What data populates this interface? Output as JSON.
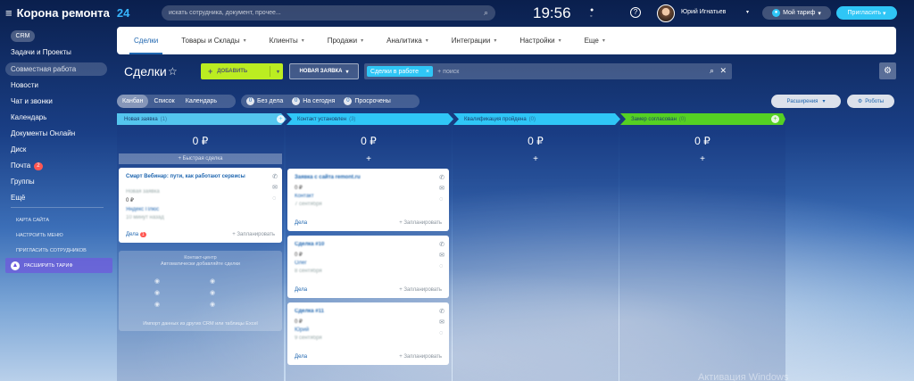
{
  "app": {
    "name": "Корона ремонта",
    "accent": "24",
    "accent_color": "#37b5ff"
  },
  "topbar": {
    "search_placeholder": "искать сотрудника, документ, прочее...",
    "time": "19:56",
    "user_name": "Юрий Игнатьев",
    "tariff_label": "Мой тариф",
    "invite_label": "Пригласить"
  },
  "sidebar": {
    "crm_label": "CRM",
    "items": [
      "Задачи и Проекты",
      "Совместная работа",
      "Новости",
      "Чат и звонки",
      "Календарь",
      "Документы Онлайн",
      "Диск",
      "Почта",
      "Группы",
      "Ещё"
    ],
    "mail_count": "2",
    "small_links": [
      "Карта сайта",
      "Настроить меню",
      "Пригласить сотрудников"
    ],
    "expand_label": "Расширить тариф"
  },
  "mainnav": {
    "items": [
      "Сделки",
      "Товары и Склады",
      "Клиенты",
      "Продажи",
      "Аналитика",
      "Интеграции",
      "Настройки",
      "Еще"
    ]
  },
  "toolbar": {
    "title": "Сделки",
    "add_label": "ДОБАВИТЬ",
    "new_request_label": "НОВАЯ ЗАЯВКА",
    "filter_chip": "Сделки в работе",
    "filter_placeholder": "+ поиск"
  },
  "views": {
    "tabs": [
      "Канбан",
      "Список",
      "Календарь"
    ],
    "counters": [
      {
        "count": "0",
        "label": "Без дела"
      },
      {
        "count": "0",
        "label": "На сегодня"
      },
      {
        "count": "0",
        "label": "Просрочены"
      }
    ],
    "extensions_label": "Расширения",
    "robots_label": "Роботы"
  },
  "columns": [
    {
      "title": "Новая заявка",
      "count": "(1)",
      "color": "#54c5ee",
      "sum": "0 ₽"
    },
    {
      "title": "Контакт установлен",
      "count": "(3)",
      "color": "#2fc6f6",
      "sum": "0 ₽"
    },
    {
      "title": "Квалификация пройдена",
      "count": "(0)",
      "color": "#2fc6f6",
      "sum": "0 ₽"
    },
    {
      "title": "Замер согласован",
      "count": "(0)",
      "color": "#55d123",
      "sum": "0 ₽"
    }
  ],
  "quick_deal_label": "+ Быстрая сделка",
  "cards": {
    "first": {
      "title": "Смарт Вебинар: пути, как работают сервисы",
      "subtitle": "Новая заявка",
      "amount": "0 ₽",
      "company": "Яндекс Плюс",
      "time": "10 минут назад",
      "foot_left": "Дела",
      "foot_badge": "1",
      "foot_right": "+ Запланировать"
    },
    "second": [
      {
        "title": "Заявка с сайта remont.ru",
        "amount": "0 ₽",
        "contact": "Контакт",
        "date": "7 сентября",
        "foot_left": "Дела",
        "foot_right": "+ Запланировать"
      },
      {
        "title": "Сделка #10",
        "amount": "0 ₽",
        "contact": "Олег",
        "date": "8 сентября",
        "foot_left": "Дела",
        "foot_right": "+ Запланировать"
      },
      {
        "title": "Сделка #11",
        "amount": "0 ₽",
        "contact": "Юрий",
        "date": "9 сентября",
        "foot_left": "Дела",
        "foot_right": "+ Запланировать"
      }
    ]
  },
  "contact_center": {
    "title": "Контакт-центр",
    "subtitle": "Автоматически добавляйте сделки",
    "footer": "Импорт данных из других CRM или таблицы Excel"
  },
  "watermark": "Активация Windows"
}
